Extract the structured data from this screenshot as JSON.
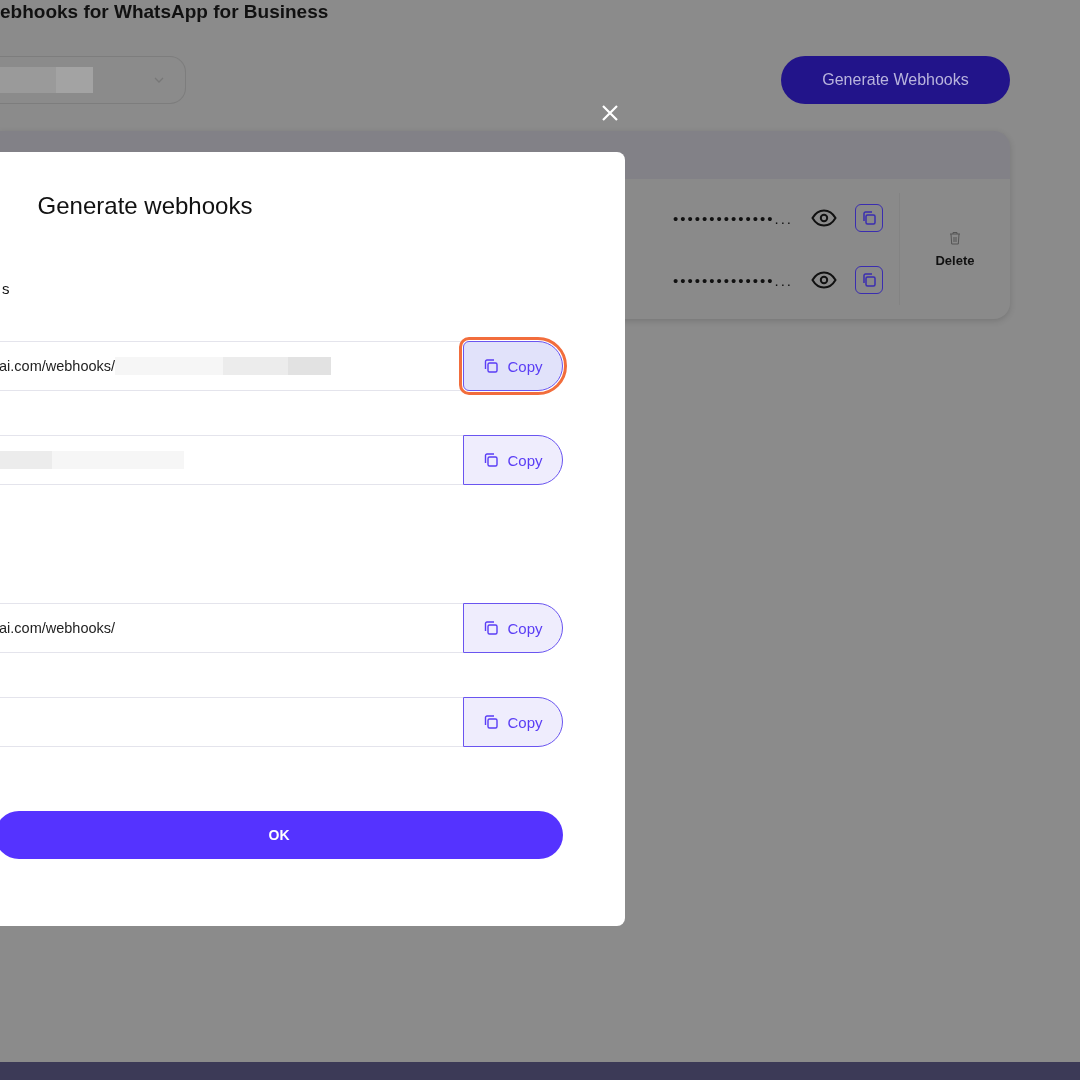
{
  "page": {
    "title": "ebhooks for WhatsApp for Business",
    "generate_button": "Generate Webhooks"
  },
  "table": {
    "rows": [
      {
        "masked_value": "••••••••••••••...",
        "delete": "Delete"
      },
      {
        "masked_value": "••••••••••••••..."
      }
    ]
  },
  "modal": {
    "title": "Generate webhooks",
    "section_label": "s",
    "groups": [
      {
        "fields": [
          {
            "value": "ai.com/webhooks/",
            "redacted": true,
            "copy": "Copy",
            "highlighted": true
          },
          {
            "redacted": true,
            "copy": "Copy",
            "highlighted": false
          }
        ]
      },
      {
        "fields": [
          {
            "value": "ai.com/webhooks/",
            "redacted": false,
            "copy": "Copy",
            "highlighted": false
          },
          {
            "redacted": false,
            "copy": "Copy",
            "highlighted": false
          }
        ]
      }
    ],
    "ok": "OK"
  }
}
